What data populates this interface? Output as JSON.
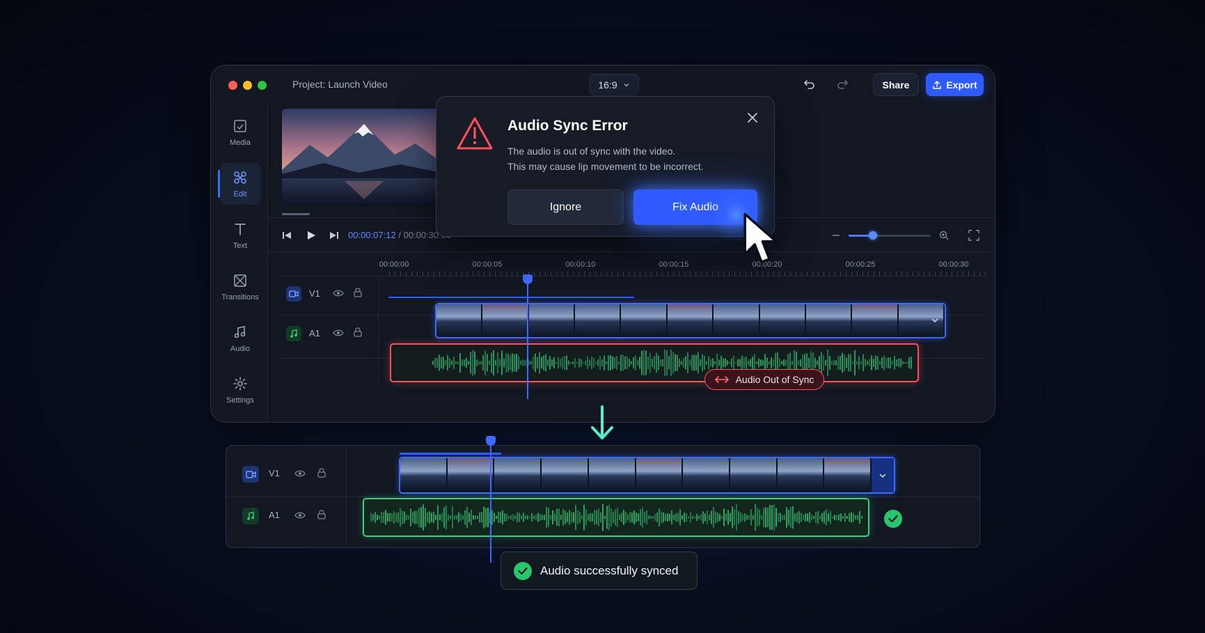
{
  "window": {
    "project_title": "Project: Launch Video",
    "aspect_ratio": "16:9",
    "share_label": "Share",
    "export_label": "Export"
  },
  "sidebar": {
    "items": [
      {
        "label": "Media",
        "icon": "media-icon"
      },
      {
        "label": "Edit",
        "icon": "edit-icon",
        "active": true
      },
      {
        "label": "Text",
        "icon": "text-icon"
      },
      {
        "label": "Transitions",
        "icon": "transitions-icon"
      },
      {
        "label": "Audio",
        "icon": "audio-icon"
      },
      {
        "label": "Settings",
        "icon": "settings-icon"
      }
    ]
  },
  "transport": {
    "current_time": "00:00:07:12",
    "total_time": "/ 00:00:30:00",
    "zoom_level": 0.3
  },
  "timeline": {
    "ruler": [
      "00:00:00",
      "00:00:05",
      "00:00:10",
      "00:00:15",
      "00:00:20",
      "00:00:25",
      "00:00:30"
    ],
    "tracks": [
      {
        "id": "V1",
        "type": "video"
      },
      {
        "id": "A1",
        "type": "audio"
      }
    ],
    "sync_badge": "Audio Out of Sync"
  },
  "dialog": {
    "title": "Audio Sync Error",
    "message_line1": "The audio is out of sync with the video.",
    "message_line2": "This may cause lip movement to be incorrect.",
    "ignore_label": "Ignore",
    "fix_label": "Fix Audio"
  },
  "result": {
    "tracks": [
      {
        "id": "V1",
        "type": "video"
      },
      {
        "id": "A1",
        "type": "audio"
      }
    ],
    "toast": "Audio successfully synced"
  },
  "colors": {
    "accent": "#2f5bff",
    "error": "#ff4f5e",
    "success": "#28c76f",
    "background": "#070d1c"
  }
}
